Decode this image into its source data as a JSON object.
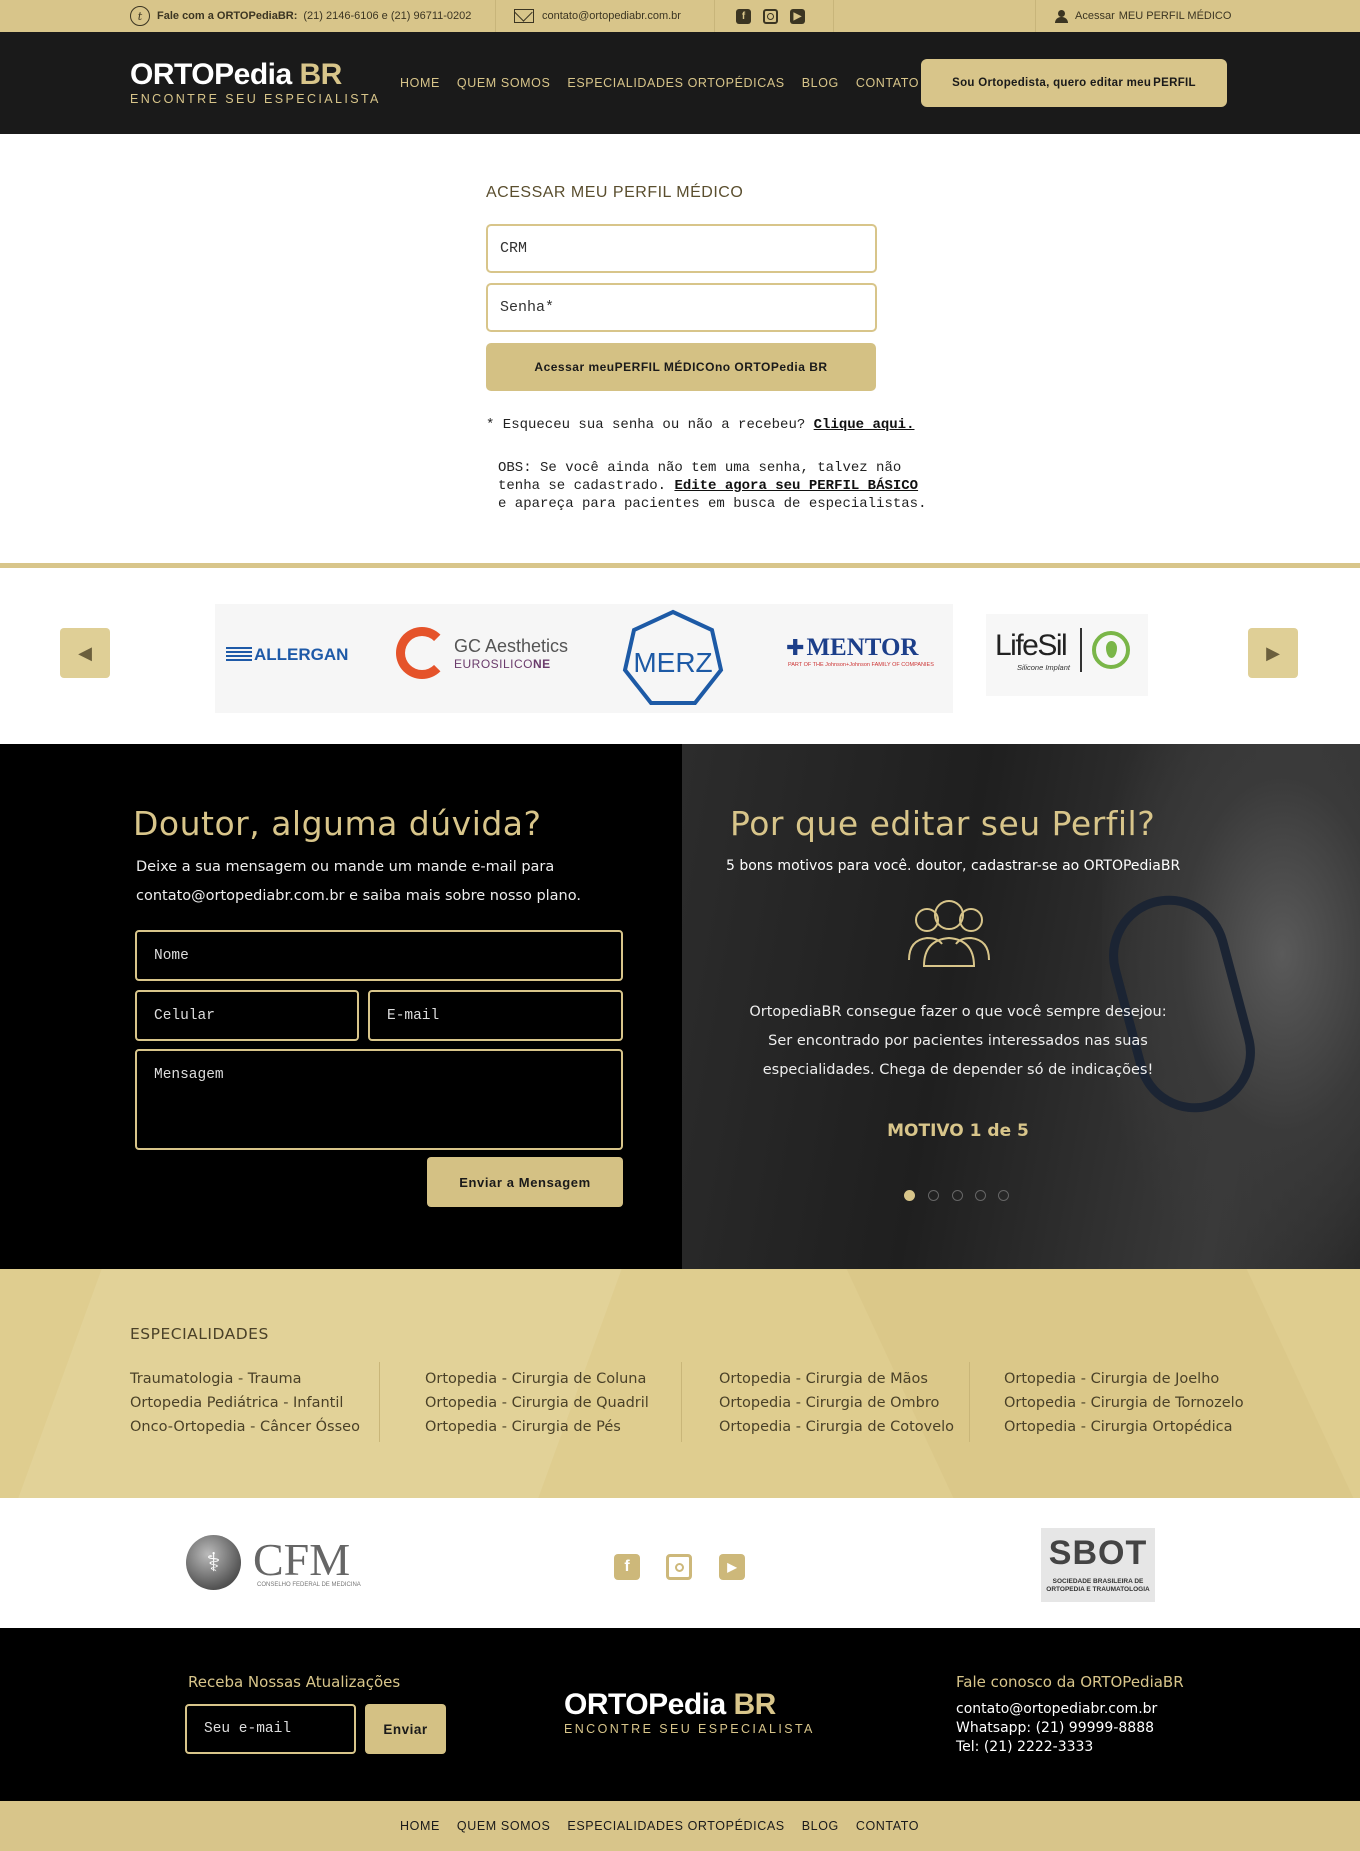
{
  "topbar": {
    "phone_label": "Fale com a ORTOPediaBR:",
    "phone_numbers": "(21) 2146-6106 e (21) 96711-0202",
    "email": "contato@ortopediabr.com.br",
    "access_prefix": "Acessar",
    "access_link": "MEU PERFIL MÉDICO"
  },
  "brand": {
    "name_main": "ORTOPedia",
    "name_br": "BR",
    "tagline": "ENCONTRE SEU ESPECIALISTA"
  },
  "nav": {
    "items": [
      "HOME",
      "QUEM SOMOS",
      "ESPECIALIDADES ORTOPÉDICAS",
      "BLOG",
      "CONTATO"
    ]
  },
  "cta": {
    "prefix": "Sou Ortopedista, quero editar meu ",
    "bold": "PERFIL"
  },
  "login": {
    "title": "ACESSAR MEU PERFIL MÉDICO",
    "crm_placeholder": "CRM",
    "password_placeholder": "Senha*",
    "button_prefix": "Acessar meu ",
    "button_bold": "PERFIL MÉDICO",
    "button_suffix": " no ORTOPedia BR",
    "forgot_text": "* Esqueceu sua senha ou não a recebeu? ",
    "forgot_link": "Clique aqui.",
    "obs_line1": "OBS: Se você ainda não tem uma senha, talvez não",
    "obs_line2_prefix": "tenha se cadastrado. ",
    "obs_line2_link": "Edite agora seu PERFIL BÁSICO",
    "obs_line3": "e apareça para pacientes em busca de especialistas."
  },
  "partners_carousel": {
    "prev_icon": "◀",
    "next_icon": "▶",
    "logos": {
      "allergan": "ALLERGAN",
      "gc_title": "GC Aesthetics",
      "gc_sub_a": "EUROSILICO",
      "gc_sub_b": "NE",
      "merz": "MERZ",
      "mentor": "MENTOR",
      "mentor_sub": "PART OF THE Johnson+Johnson FAMILY OF COMPANIES",
      "lifesil": "LifeSil",
      "lifesil_sub": "Silicone Implant"
    }
  },
  "contact": {
    "title": "Doutor, alguma dúvida?",
    "line1": "Deixe a sua mensagem ou mande um mande e-mail para",
    "line2": "contato@ortopediabr.com.br e saiba mais sobre nosso plano.",
    "name_placeholder": "Nome",
    "phone_placeholder": "Celular",
    "email_placeholder": "E-mail",
    "message_placeholder": "Mensagem",
    "send_label": "Enviar a Mensagem"
  },
  "why": {
    "title": "Por que  editar seu Perfil?",
    "subtitle": "5 bons motivos para você. doutor, cadastrar-se ao ORTOPediaBR",
    "text1": "OrtopediaBR consegue fazer o que você sempre desejou:",
    "text2": "Ser encontrado por pacientes interessados nas suas",
    "text3": "especialidades. Chega de depender só de indicações!",
    "motivo": "MOTIVO 1 de 5",
    "active_dot": 1,
    "total_dots": 5
  },
  "specialties": {
    "title": "ESPECIALIDADES",
    "col1": [
      "Traumatologia -  Trauma",
      "Ortopedia Pediátrica - Infantil",
      "Onco-Ortopedia - Câncer Ósseo"
    ],
    "col2": [
      "Ortopedia - Cirurgia de Coluna",
      "Ortopedia - Cirurgia de Quadril",
      "Ortopedia - Cirurgia de Pés"
    ],
    "col3": [
      "Ortopedia - Cirurgia de Mãos",
      "Ortopedia - Cirurgia de Ombro",
      "Ortopedia - Cirurgia de Cotovelo"
    ],
    "col4": [
      "Ortopedia - Cirurgia de Joelho",
      "Ortopedia - Cirurgia de Tornozelo",
      "Ortopedia - Cirurgia Ortopédica"
    ]
  },
  "institutions": {
    "cfm": "CFM",
    "cfm_sub": "CONSELHO FEDERAL DE MEDICINA",
    "sbot": "SBOT",
    "sbot_sub1": "SOCIEDADE BRASILEIRA DE",
    "sbot_sub2": "ORTOPEDIA E TRAUMATOLOGIA"
  },
  "footer": {
    "newsletter_title": "Receba Nossas Atualizações",
    "newsletter_placeholder": "Seu e-mail",
    "newsletter_button": "Enviar",
    "contact_title": "Fale conosco da ORTOPediaBR",
    "contact_email": "contato@ortopediabr.com.br",
    "contact_whatsapp": "Whatsapp: (21) 99999-8888",
    "contact_tel": "Tel: (21) 2222-3333"
  },
  "colors": {
    "gold": "#d8c58a",
    "dark": "#1a1a1a",
    "black": "#000000"
  }
}
